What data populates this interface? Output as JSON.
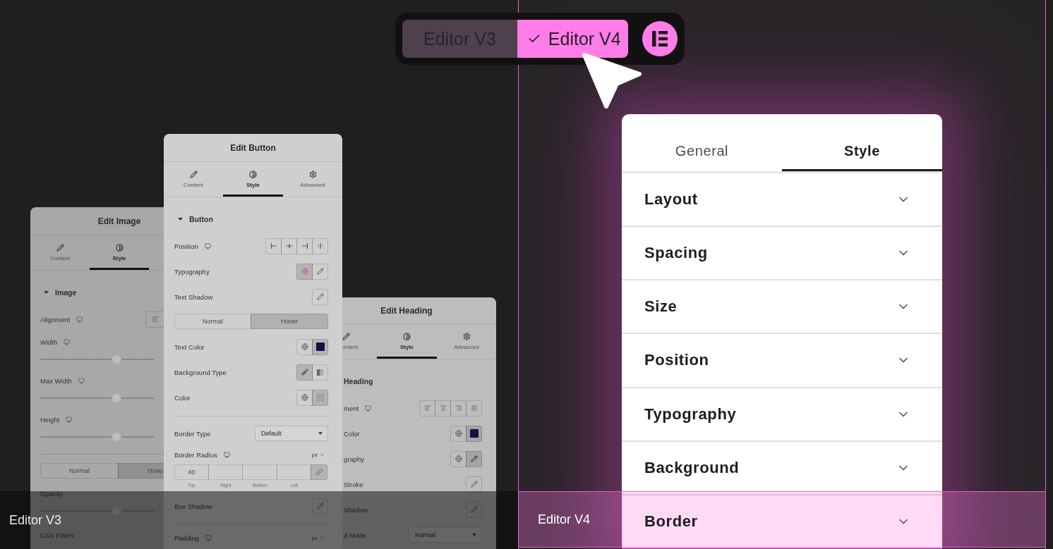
{
  "editor_switch": {
    "options": [
      {
        "label": "Editor V3",
        "selected": false
      },
      {
        "label": "Editor V4",
        "selected": true
      }
    ]
  },
  "v3_panels": [
    {
      "title": "Edit Image",
      "tabs": [
        {
          "label": "Content",
          "selected": false
        },
        {
          "label": "Style",
          "selected": true
        }
      ],
      "rows": [
        {
          "kind": "section",
          "label": "Image"
        },
        {
          "kind": "buttons",
          "label": "Alignment",
          "responsive": true,
          "buttons": [
            {
              "kind": "align-left",
              "active": false
            }
          ]
        },
        {
          "kind": "slider",
          "label": "Width",
          "responsive": true,
          "level": 0.67
        },
        {
          "kind": "slider",
          "label": "Max Width",
          "responsive": true,
          "level": 0.67
        },
        {
          "kind": "slider",
          "label": "Height",
          "responsive": true,
          "level": 0.67
        },
        {
          "kind": "states",
          "divider": true,
          "options": [
            {
              "label": "Normal",
              "selected": false
            },
            {
              "label": "Hove",
              "selected": true
            }
          ]
        },
        {
          "kind": "slider",
          "label": "Opacity",
          "responsive": false,
          "level": 0.67
        },
        {
          "kind": "buttons",
          "label": "CSS Filters",
          "responsive": false
        }
      ]
    },
    {
      "title": "Edit Button",
      "tabs": [
        {
          "label": "Content",
          "selected": false
        },
        {
          "label": "Style",
          "selected": true
        },
        {
          "label": "Advanced",
          "selected": false
        }
      ],
      "rows": [
        {
          "kind": "section",
          "label": "Button"
        },
        {
          "kind": "buttons",
          "label": "Position",
          "responsive": true,
          "buttons": [
            {
              "kind": "start",
              "active": false
            },
            {
              "kind": "center",
              "active": false
            },
            {
              "kind": "end",
              "active": false
            },
            {
              "kind": "custom",
              "active": false
            }
          ]
        },
        {
          "kind": "buttons",
          "label": "Typography",
          "responsive": false,
          "buttons": [
            {
              "kind": "global",
              "active": true
            },
            {
              "kind": "edit",
              "active": false
            }
          ]
        },
        {
          "kind": "buttons",
          "label": "Text Shadow",
          "responsive": false,
          "buttons": [
            {
              "kind": "edit",
              "active": false
            }
          ]
        },
        {
          "kind": "states",
          "options": [
            {
              "label": "Normal",
              "selected": false
            },
            {
              "label": "Hover",
              "selected": true
            }
          ]
        },
        {
          "kind": "buttons",
          "label": "Text Color",
          "responsive": false,
          "buttons": [
            {
              "kind": "global",
              "active": false
            },
            {
              "kind": "swatch",
              "active": true,
              "color": "#1e0c45"
            }
          ]
        },
        {
          "kind": "buttons",
          "label": "Background Type",
          "responsive": false,
          "buttons": [
            {
              "kind": "classic",
              "active": true
            },
            {
              "kind": "gradient",
              "active": false
            }
          ]
        },
        {
          "kind": "buttons",
          "label": "Color",
          "responsive": false,
          "buttons": [
            {
              "kind": "global",
              "active": false
            },
            {
              "kind": "swatch",
              "active": true,
              "color": "#a4a4a4"
            }
          ]
        },
        {
          "kind": "select",
          "label": "Border Type",
          "divider": true,
          "value": "Default"
        },
        {
          "kind": "dimensions",
          "label": "Border Radius",
          "responsive": true,
          "unit": "px",
          "linked": true,
          "fields": [
            {
              "value": "40",
              "caption": "Top"
            },
            {
              "caption": "Right"
            },
            {
              "caption": "Bottom"
            },
            {
              "caption": "Left"
            }
          ]
        },
        {
          "kind": "buttons",
          "label": "Box Shadow",
          "responsive": false,
          "buttons": [
            {
              "kind": "edit",
              "active": false
            }
          ]
        },
        {
          "kind": "units",
          "label": "Padding",
          "divider": true,
          "responsive": true,
          "unit": "px"
        }
      ]
    },
    {
      "title": "Edit Heading",
      "tabs": [
        {
          "label": "ontent",
          "selected": false
        },
        {
          "label": "Style",
          "selected": true
        },
        {
          "label": "Advanced",
          "selected": false
        }
      ],
      "rows": [
        {
          "kind": "section",
          "label": "Heading"
        },
        {
          "kind": "buttons",
          "label": "ment",
          "responsive": true,
          "buttons": [
            {
              "kind": "align-left",
              "active": false
            },
            {
              "kind": "align-center",
              "active": false
            },
            {
              "kind": "align-right",
              "active": false
            },
            {
              "kind": "justify",
              "active": false
            }
          ]
        },
        {
          "kind": "buttons",
          "label": "Color",
          "responsive": false,
          "buttons": [
            {
              "kind": "global",
              "active": false
            },
            {
              "kind": "swatch",
              "active": true,
              "color": "#1e0c45"
            }
          ]
        },
        {
          "kind": "buttons",
          "label": "graphy",
          "responsive": false,
          "buttons": [
            {
              "kind": "global",
              "active": false
            },
            {
              "kind": "edit",
              "active": true
            }
          ]
        },
        {
          "kind": "buttons",
          "label": "Stroke",
          "responsive": false,
          "buttons": [
            {
              "kind": "edit",
              "active": false
            }
          ]
        },
        {
          "kind": "buttons",
          "label": "Shadow",
          "responsive": false,
          "buttons": [
            {
              "kind": "edit",
              "active": false
            }
          ]
        },
        {
          "kind": "select",
          "label": "d Mode",
          "value": "Normal"
        }
      ]
    }
  ],
  "v4_panel": {
    "tabs": [
      {
        "label": "General",
        "selected": false
      },
      {
        "label": "Style",
        "selected": true
      }
    ],
    "sections": [
      {
        "label": "Layout",
        "expanded": false
      },
      {
        "label": "Spacing",
        "expanded": false
      },
      {
        "label": "Size",
        "expanded": false
      },
      {
        "label": "Position",
        "expanded": false
      },
      {
        "label": "Typography",
        "expanded": false
      },
      {
        "label": "Background",
        "expanded": false
      },
      {
        "label": "Border",
        "expanded": false
      }
    ]
  },
  "v3_caption": "Editor V3",
  "v4_caption": "Editor V4"
}
